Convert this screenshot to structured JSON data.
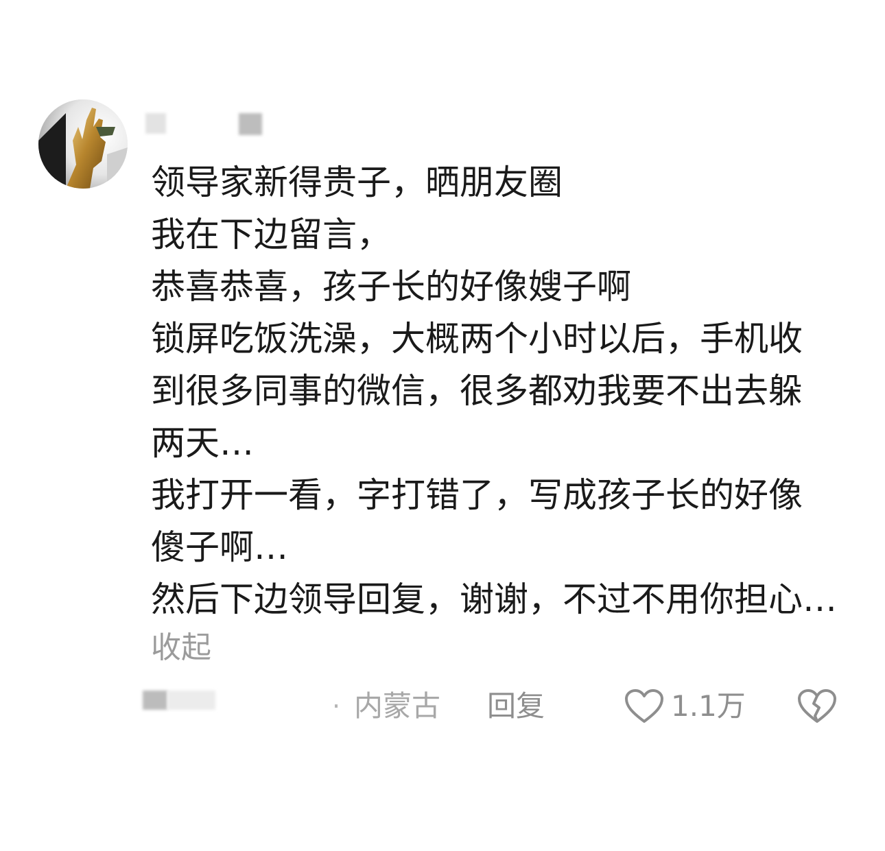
{
  "comment": {
    "lines": [
      "领导家新得贵子，晒朋友圈",
      "我在下边留言，",
      "恭喜恭喜，孩子长的好像嫂子啊",
      "锁屏吃饭洗澡，大概两个小时以后，手机收",
      "到很多同事的微信，很多都劝我要不出去躲",
      "两天…",
      "我打开一看，字打错了，写成孩子长的好像",
      "傻子啊…",
      "然后下边领导回复，谢谢，不过不用你担心…"
    ],
    "collapse_label": "收起"
  },
  "meta": {
    "separator": "·",
    "location": "内蒙古",
    "reply_label": "回复",
    "like_count": "1.1万"
  },
  "icons": {
    "like": "heart-outline-icon",
    "dislike": "broken-heart-icon"
  },
  "colors": {
    "text": "#1a1a1a",
    "secondary": "#8e8e8e",
    "background": "#ffffff"
  }
}
